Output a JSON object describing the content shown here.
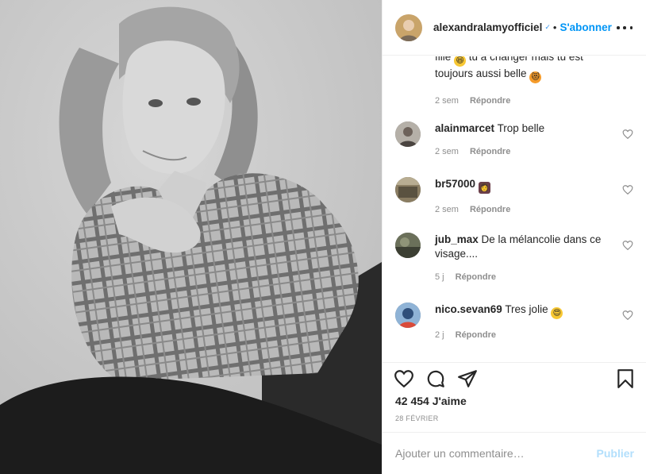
{
  "header": {
    "username": "alexandralamyofficiel",
    "verified_mark": "✓",
    "separator": "•",
    "follow_label": "S'abonner"
  },
  "partial_comment": {
    "line1_a": "fille",
    "line1_b": "tu a changer mais tu est",
    "line2": "toujours aussi belle",
    "time": "2 sem",
    "reply": "Répondre",
    "emojis": [
      "grinning-squint-face",
      "cat-face"
    ]
  },
  "comments": [
    {
      "username": "alainmarcet",
      "text": "Trop belle",
      "time": "2 sem",
      "reply": "Répondre",
      "emoji": null
    },
    {
      "username": "br57000",
      "text": "",
      "time": "2 sem",
      "reply": "Répondre",
      "emoji": "person-emoji"
    },
    {
      "username": "jub_max",
      "text": "De la mélancolie dans ce visage....",
      "time": "5 j",
      "reply": "Répondre",
      "emoji": null
    },
    {
      "username": "nico.sevan69",
      "text": "Tres jolie",
      "time": "2 j",
      "reply": "Répondre",
      "emoji": "heart-eyes-face"
    }
  ],
  "actions": {
    "icons": [
      "heart-icon",
      "comment-icon",
      "share-icon",
      "bookmark-icon"
    ],
    "likes_count": "42 454",
    "likes_label": "J'aime",
    "date": "28 février"
  },
  "composer": {
    "placeholder": "Ajouter un commentaire…",
    "publish_label": "Publier"
  },
  "colors": {
    "accent": "#0095f6",
    "publish_disabled": "#b2dffc",
    "muted": "#8e8e8e",
    "text": "#262626",
    "border": "#efefef"
  }
}
